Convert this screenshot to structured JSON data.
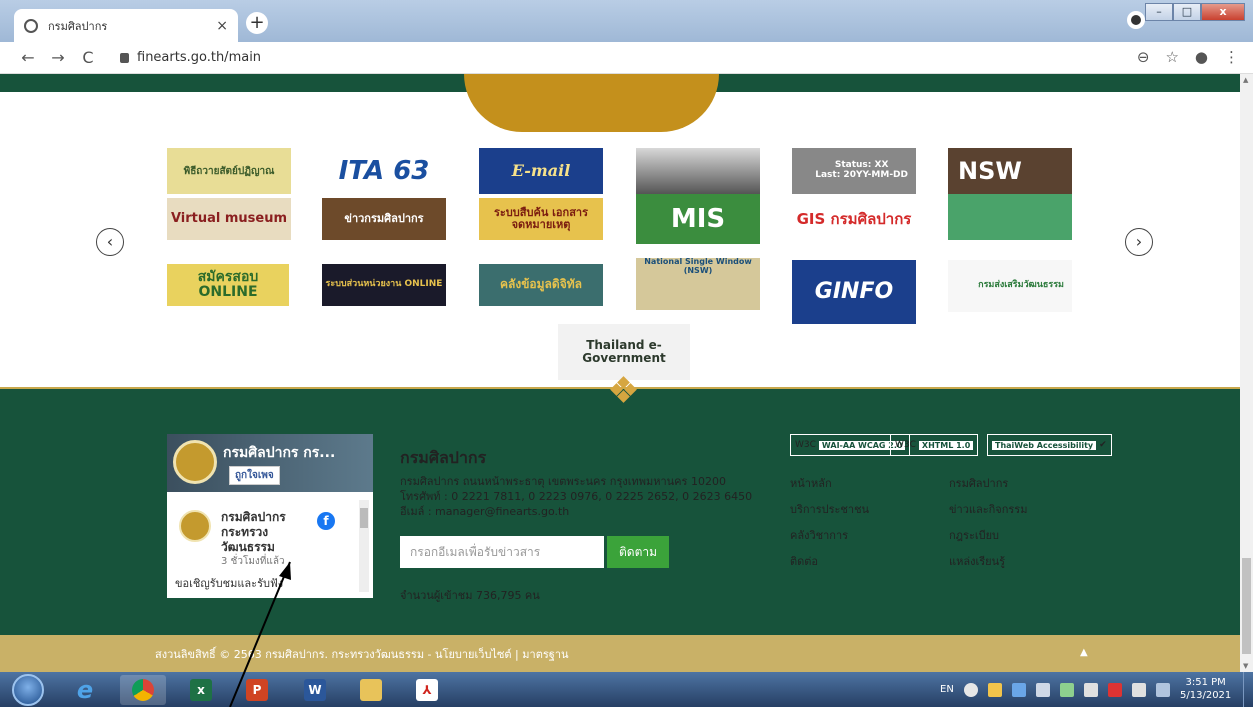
{
  "browser": {
    "tab_title": "กรมศิลปากร",
    "tab_close": "×",
    "new_tab": "+",
    "window_controls": {
      "minimize": "–",
      "maximize": "□",
      "close": "x"
    },
    "nav": {
      "back": "←",
      "forward": "→",
      "reload": "C"
    },
    "url": "finearts.go.th/main"
  },
  "carousel": {
    "prev": "‹",
    "next": "›",
    "banners": {
      "b1": "พิธีถวายสัตย์ปฏิญาณ",
      "b2": "ITA 63",
      "b3": "E-mail",
      "b4": "",
      "b5": "Status: XX\nLast: 20YY-MM-DD",
      "b6": "NSW",
      "b7": "Virtual museum",
      "b8": "ข่าวกรมศิลปากร",
      "b9": "ระบบสืบค้น เอกสารจดหมายเหตุ",
      "b10": "MIS",
      "b11": "GIS กรมศิลปากร",
      "b12": "",
      "b13": "สมัครสอบ ONLINE",
      "b14": "ระบบส่วนหน่วยงาน ONLINE",
      "b15": "คลังข้อมูลดิจิทัล",
      "b16": "National Single Window (NSW)",
      "b17": "GINFO",
      "b18": "กรมส่งเสริมวัฒนธรรม",
      "b19": "Thailand e-Government"
    }
  },
  "facebook": {
    "page_name": "กรมศิลปากร กร...",
    "like_button": "ถูกใจเพจ",
    "post_author": "กรมศิลปากร กระทรวงวัฒนธรรม",
    "post_time": "3 ชั่วโมงที่แล้ว",
    "post_text": "ขอเชิญรับชมและรับฟัง"
  },
  "footer": {
    "org_title": "กรมศิลปากร",
    "address": "กรมศิลปากร ถนนหน้าพระธาตุ เขตพระนคร กรุงเทพมหานคร 10200",
    "phone": "โทรศัพท์ : 0 2221 7811, 0 2223 0976, 0 2225 2652, 0 2623 6450",
    "email": "อีเมล์ : manager@finearts.go.th",
    "subscribe_placeholder": "กรอกอีเมลเพื่อรับข่าวสาร",
    "subscribe_button": "ติดตาม",
    "visitors": "จำนวนผู้เข้าชม 736,795 คน",
    "badges": {
      "wai": "WAI-AA WCAG 2.0",
      "xhtml": "XHTML 1.0",
      "thaiweb": "ThaiWeb Accessibility"
    },
    "links": {
      "home": "หน้าหลัก",
      "dept": "กรมศิลปากร",
      "services": "บริการประชาชน",
      "news": "ข่าวและกิจกรรม",
      "knowledge": "คลังวิชาการ",
      "rules": "กฎระเบียบ",
      "contact": "ติดต่อ",
      "learning": "แหล่งเรียนรู้"
    },
    "copyright": "สงวนลิขสิทธิ์ © 2563 กรมศิลปากร. กระทรวงวัฒนธรรม - นโยบายเว็บไซต์ | มาตรฐาน",
    "back_to_top": "▲"
  },
  "taskbar": {
    "lang": "EN",
    "time": "3:51 PM",
    "date": "5/13/2021"
  }
}
